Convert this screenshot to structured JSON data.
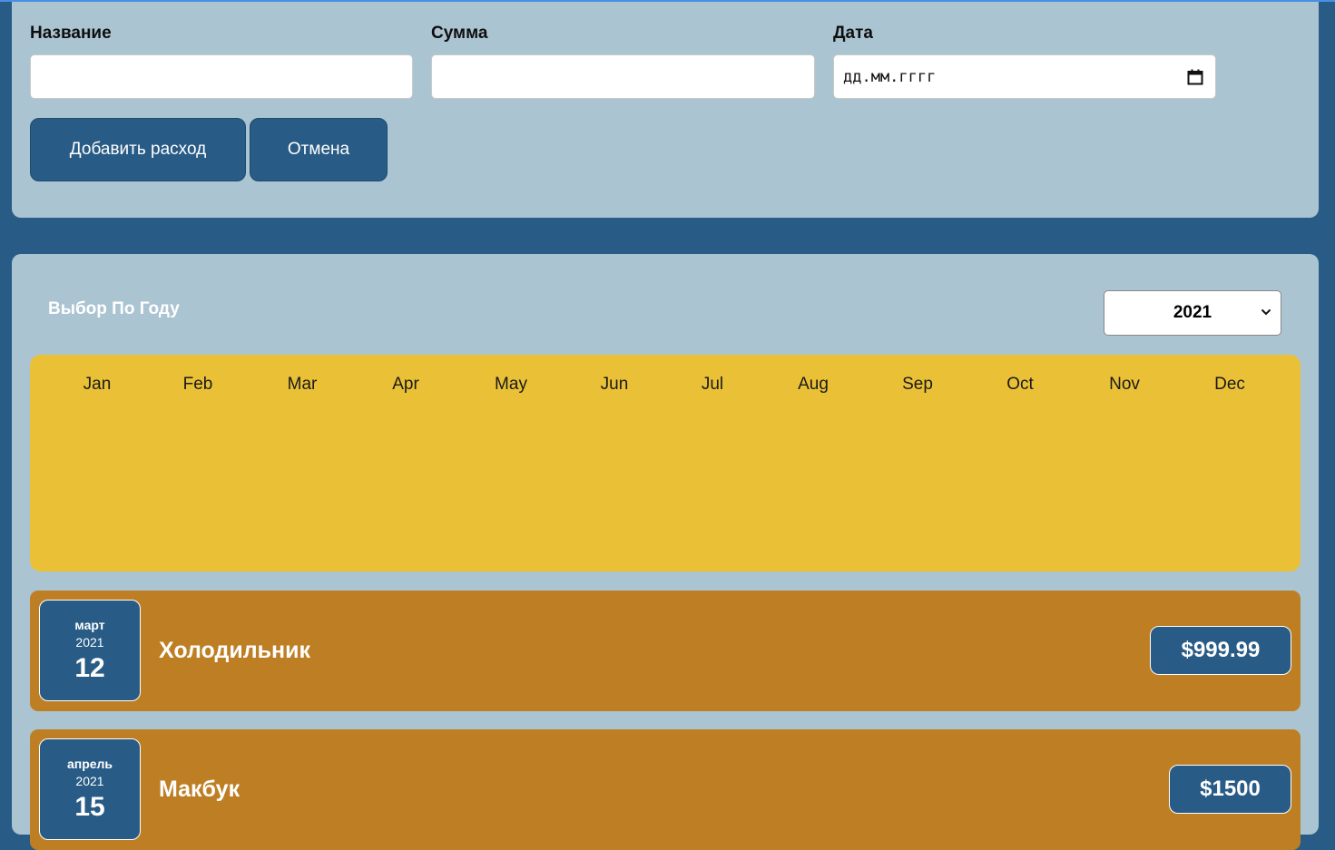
{
  "form": {
    "title_label": "Название",
    "amount_label": "Сумма",
    "date_label": "Дата",
    "title_value": "",
    "amount_value": "",
    "date_placeholder": "дд.мм.гггг",
    "add_button": "Добавить расход",
    "cancel_button": "Отмена"
  },
  "filter": {
    "label": "Выбор По Году",
    "selected_year": "2021"
  },
  "chart_data": {
    "type": "bar",
    "categories": [
      "Jan",
      "Feb",
      "Mar",
      "Apr",
      "May",
      "Jun",
      "Jul",
      "Aug",
      "Sep",
      "Oct",
      "Nov",
      "Dec"
    ],
    "values": [
      0,
      0,
      0,
      0,
      0,
      0,
      0,
      0,
      0,
      0,
      0,
      0
    ],
    "title": "",
    "xlabel": "",
    "ylabel": ""
  },
  "expenses": [
    {
      "month": "март",
      "year": "2021",
      "day": "12",
      "title": "Холодильник",
      "amount": "$999.99"
    },
    {
      "month": "апрель",
      "year": "2021",
      "day": "15",
      "title": "Макбук",
      "amount": "$1500"
    }
  ],
  "colors": {
    "background": "#285b85",
    "card": "#abc4d2",
    "chart": "#eac136",
    "expense_item": "#be7f24",
    "button": "#285b85"
  },
  "icons": {
    "calendar": "calendar-icon",
    "select_arrow": "chevron-down-icon"
  }
}
